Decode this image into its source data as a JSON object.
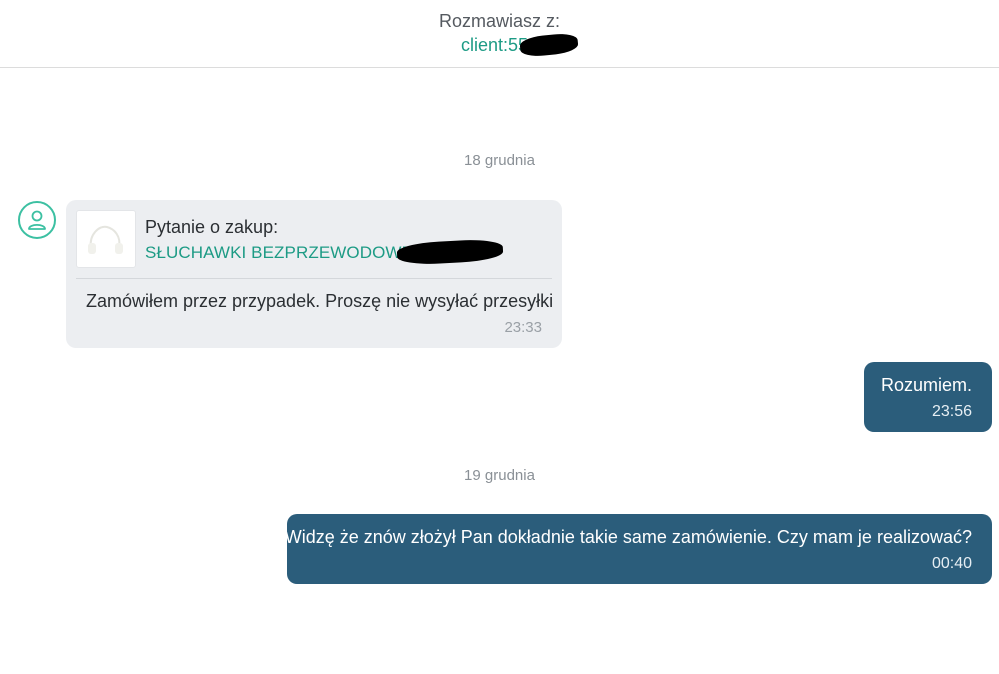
{
  "header": {
    "label": "Rozmawiasz z:",
    "client_name": "client:556"
  },
  "conversation": {
    "date_1": "18 grudnia",
    "date_2": "19 grudnia",
    "incoming": {
      "product_question": "Pytanie o zakup:",
      "product_name": "SŁUCHAWKI BEZPRZEWODOWE",
      "text": "Zamówiłem przez przypadek. Proszę nie wysyłać przesyłki",
      "time": "23:33"
    },
    "outgoing": [
      {
        "text": "Rozumiem.",
        "time": "23:56"
      },
      {
        "text": "Widzę że znów złożył Pan dokładnie takie same zamówienie. Czy mam je realizować?",
        "time": "00:40"
      }
    ]
  },
  "colors": {
    "accent": "#1d9b85",
    "outgoing_bubble": "#2b5d7b",
    "incoming_bubble": "#eceef1"
  },
  "icons": {
    "avatar": "user-icon",
    "product": "product-thumbnail"
  }
}
